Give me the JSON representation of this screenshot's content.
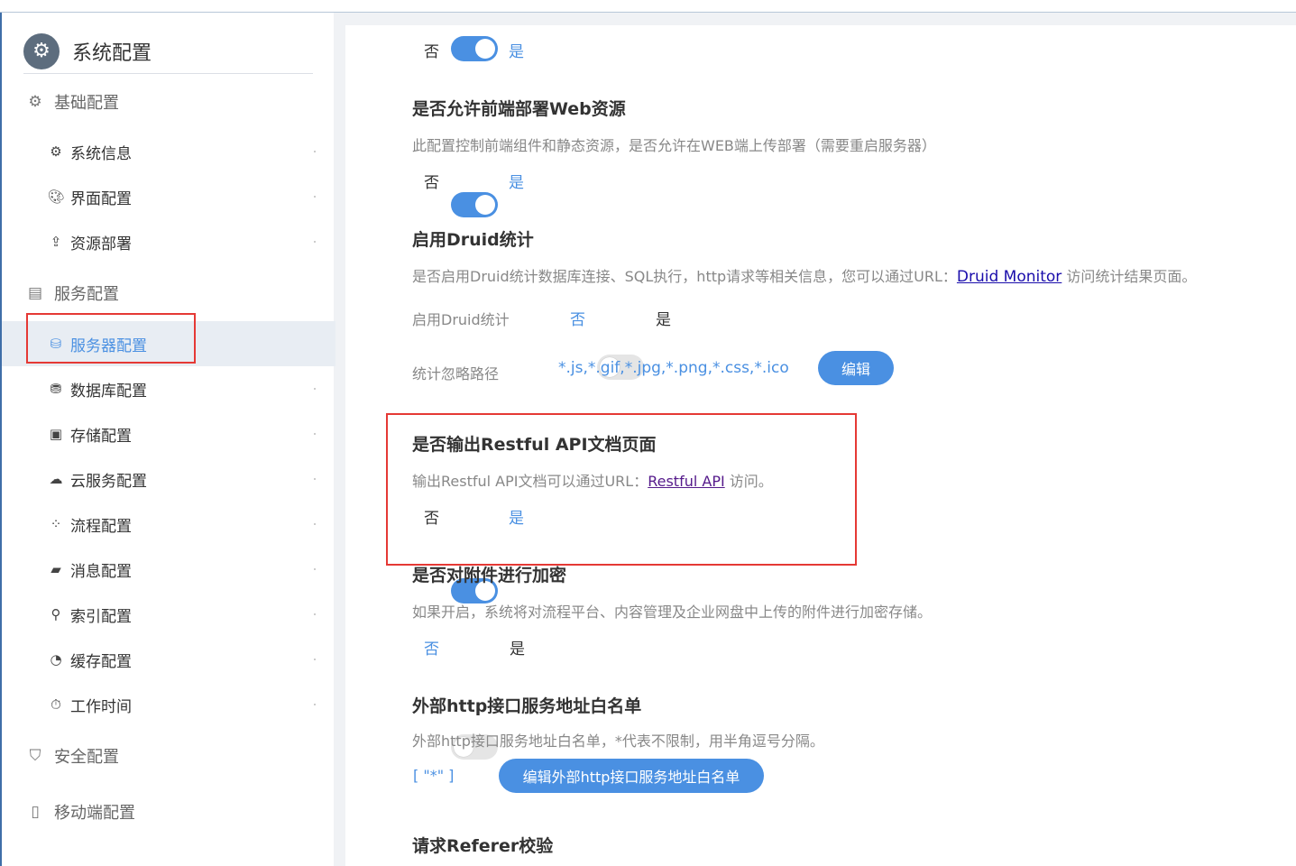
{
  "sidebar": {
    "title": "系统配置",
    "title_icon": "gear-icon",
    "groups": [
      {
        "label": "基础配置",
        "icon": "gear-icon"
      },
      {
        "label": "服务配置",
        "icon": "server-icon"
      },
      {
        "label": "安全配置",
        "icon": "shield-icon"
      },
      {
        "label": "移动端配置",
        "icon": "mobile-icon"
      }
    ],
    "items": [
      {
        "label": "系统信息",
        "icon": "gear-icon"
      },
      {
        "label": "界面配置",
        "icon": "palette-icon"
      },
      {
        "label": "资源部署",
        "icon": "upload-icon"
      },
      {
        "label": "服务器配置",
        "icon": "server-user-icon",
        "active": true
      },
      {
        "label": "数据库配置",
        "icon": "database-icon"
      },
      {
        "label": "存储配置",
        "icon": "archive-icon"
      },
      {
        "label": "云服务配置",
        "icon": "cloud-icon"
      },
      {
        "label": "流程配置",
        "icon": "flow-icon"
      },
      {
        "label": "消息配置",
        "icon": "message-icon"
      },
      {
        "label": "索引配置",
        "icon": "search-icon"
      },
      {
        "label": "缓存配置",
        "icon": "pie-icon"
      },
      {
        "label": "工作时间",
        "icon": "stopwatch-icon"
      }
    ]
  },
  "main": {
    "top_toggle": {
      "no": "否",
      "yes": "是",
      "on": true
    },
    "web_resource": {
      "title": "是否允许前端部署Web资源",
      "desc": "此配置控制前端组件和静态资源，是否允许在WEB端上传部署（需要重启服务器）",
      "no": "否",
      "yes": "是",
      "on": true
    },
    "druid": {
      "title": "启用Druid统计",
      "desc_prefix": "是否启用Druid统计数据库连接、SQL执行，http请求等相关信息，您可以通过URL：",
      "link": "Druid Monitor",
      "desc_suffix": " 访问统计结果页面。",
      "enable_label": "启用Druid统计",
      "no": "否",
      "yes": "是",
      "on": false,
      "ignore_label": "统计忽略路径",
      "ignore_value": "*.js,*.gif,*.jpg,*.png,*.css,*.ico",
      "edit_button": "编辑"
    },
    "restful": {
      "title": "是否输出Restful API文档页面",
      "desc_prefix": "输出Restful API文档可以通过URL：",
      "link": "Restful API",
      "desc_suffix": " 访问。",
      "no": "否",
      "yes": "是",
      "on": true
    },
    "attachment": {
      "title": "是否对附件进行加密",
      "desc": "如果开启，系统将对流程平台、内容管理及企业网盘中上传的附件进行加密存储。",
      "no": "否",
      "yes": "是",
      "on": false
    },
    "whitelist": {
      "title": "外部http接口服务地址白名单",
      "desc": "外部http接口服务地址白名单，*代表不限制，用半角逗号分隔。",
      "value": "[ \"*\" ]",
      "edit_button": "编辑外部http接口服务地址白名单"
    },
    "referer": {
      "title": "请求Referer校验"
    }
  },
  "colors": {
    "accent": "#4a90e2",
    "highlight_box": "#e53935"
  }
}
